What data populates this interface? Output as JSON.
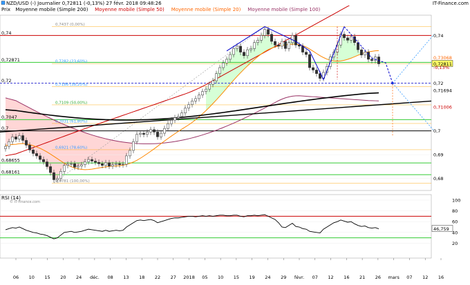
{
  "header": {
    "line1_left": "NZD/USD (-) Journalier 0,72811 (-0,13%) 27 févr. 2018 09:48:26",
    "line1_right": "IT-Finance.com",
    "legend": [
      {
        "label": "Prix",
        "color": "#000000"
      },
      {
        "label": "Moyenne mobile (Simple 200)",
        "color": "#000000"
      },
      {
        "label": "Moyenne mobile (Simple 50)",
        "color": "#cc0000"
      },
      {
        "label": "Moyenne mobile (Simple 20)",
        "color": "#ff6600"
      },
      {
        "label": "Moyenne mobile (Simple 100)",
        "color": "#993366"
      }
    ]
  },
  "colors": {
    "up_candle": "#ffffff",
    "down_candle": "#333333",
    "sma200": "#000000",
    "sma50": "#cc0000",
    "sma20": "#ff8800",
    "sma100": "#993366",
    "fib": "#ffa500",
    "green": "#33cc33",
    "red_level": "#cc0000",
    "pattern": "#0000cc",
    "projection": "#3399ff"
  },
  "chart_data": [
    {
      "type": "candlestick",
      "title": "NZD/USD (-) Journalier",
      "last_value": "0,72811",
      "change": "-0,13%",
      "ylim": [
        0.675,
        0.7485
      ],
      "y_ticks": [
        "0,74",
        "0,72",
        "0,7",
        "0,69",
        "0,68"
      ],
      "left_labels": [
        "0,74",
        "0,72871",
        "0,72",
        "0,7047",
        "0,7",
        "0,68655",
        "0,68161"
      ],
      "right_labels": [
        {
          "text": "0,74",
          "value": 0.74,
          "color": "#000000",
          "bg": null
        },
        {
          "text": "0,73068",
          "value": 0.73068,
          "color": "#ff6600",
          "bg": null
        },
        {
          "text": "0,72811",
          "value": 0.72811,
          "color": "#000000",
          "bg": "#ffff66"
        },
        {
          "text": "-0,13%",
          "value": 0.7266,
          "color": "#cc0000",
          "bg": null
        },
        {
          "text": "0,72",
          "value": 0.72,
          "color": "#000000",
          "bg": null
        },
        {
          "text": "0,71694",
          "value": 0.71694,
          "color": "#000000",
          "bg": null
        },
        {
          "text": "0,71006",
          "value": 0.71006,
          "color": "#cc0000",
          "bg": null
        },
        {
          "text": "0,7",
          "value": 0.7,
          "color": "#000000",
          "bg": null
        },
        {
          "text": "0,69",
          "value": 0.69,
          "color": "#000000",
          "bg": null
        },
        {
          "text": "0,68",
          "value": 0.68,
          "color": "#000000",
          "bg": null
        }
      ],
      "x_labels": [
        "06",
        "10",
        "15",
        "20",
        "24",
        "déc.",
        "08",
        "13",
        "18",
        "22",
        "27",
        "2018",
        "05",
        "10",
        "15",
        "19",
        "24",
        "29",
        "févr.",
        "07",
        "12",
        "16",
        "21",
        "26",
        "mars",
        "07",
        "12",
        "16"
      ],
      "fib_levels": [
        {
          "label": "0,7437 (0,00%)",
          "value": 0.7437
        },
        {
          "label": "0,7282 (23,60%)",
          "value": 0.7282
        },
        {
          "label": "0,7186 (38,20%)",
          "value": 0.7186
        },
        {
          "label": "0,7109 (50,00%)",
          "value": 0.7109
        },
        {
          "label": "0,7031 (61,80%)",
          "value": 0.7031
        },
        {
          "label": "0,6921 (78,60%)",
          "value": 0.6921
        },
        {
          "label": "0,6781 (100,00%)",
          "value": 0.6781
        }
      ],
      "horizontal_levels": [
        {
          "value": 0.74,
          "color": "#cc0000"
        },
        {
          "value": 0.72871,
          "color": "#33cc33"
        },
        {
          "value": 0.7047,
          "color": "#33cc33"
        },
        {
          "value": 0.7,
          "color": "#000000"
        },
        {
          "value": 0.68655,
          "color": "#33cc33"
        },
        {
          "value": 0.68161,
          "color": "#33cc33"
        }
      ],
      "closes": [
        0.6935,
        0.6955,
        0.6975,
        0.6965,
        0.698,
        0.696,
        0.694,
        0.692,
        0.6905,
        0.6895,
        0.688,
        0.687,
        0.685,
        0.6825,
        0.6795,
        0.68,
        0.683,
        0.6855,
        0.686,
        0.6862,
        0.6848,
        0.6852,
        0.6858,
        0.687,
        0.688,
        0.6873,
        0.6868,
        0.6862,
        0.6855,
        0.6866,
        0.6852,
        0.6858,
        0.6862,
        0.6858,
        0.686,
        0.6895,
        0.6918,
        0.6955,
        0.6985,
        0.699,
        0.6985,
        0.6995,
        0.7005,
        0.6995,
        0.6975,
        0.699,
        0.701,
        0.703,
        0.7045,
        0.7055,
        0.706,
        0.7075,
        0.7095,
        0.711,
        0.7125,
        0.7135,
        0.715,
        0.7165,
        0.7175,
        0.7195,
        0.721,
        0.724,
        0.7265,
        0.7285,
        0.73,
        0.732,
        0.7345,
        0.7355,
        0.733,
        0.7315,
        0.734,
        0.7345,
        0.737,
        0.738,
        0.74,
        0.7425,
        0.7405,
        0.7375,
        0.736,
        0.7355,
        0.7375,
        0.7345,
        0.737,
        0.74,
        0.736,
        0.7355,
        0.733,
        0.732,
        0.7265,
        0.7255,
        0.724,
        0.722,
        0.7245,
        0.727,
        0.731,
        0.733,
        0.736,
        0.7405,
        0.739,
        0.738,
        0.7395,
        0.737,
        0.734,
        0.7318,
        0.733,
        0.73,
        0.7295,
        0.731,
        0.7281
      ],
      "rsi": {
        "label": "RSI (14)",
        "ylim": [
          0,
          100
        ],
        "y_ticks": [
          "100",
          "80",
          "60",
          "40",
          "20"
        ],
        "overbought": 70,
        "oversold": 30,
        "last_label": "46,759",
        "values": [
          45,
          47,
          49,
          48,
          50,
          47,
          44,
          42,
          40,
          39,
          37,
          36,
          34,
          31,
          28,
          30,
          35,
          40,
          41,
          42,
          40,
          41,
          42,
          44,
          46,
          45,
          44,
          43,
          42,
          44,
          42,
          43,
          44,
          43,
          44,
          50,
          54,
          58,
          62,
          63,
          62,
          63,
          64,
          62,
          58,
          60,
          62,
          64,
          66,
          67,
          67,
          68,
          69,
          70,
          70,
          69,
          70,
          71,
          70,
          71,
          70,
          71,
          72,
          72,
          71,
          71,
          72,
          72,
          70,
          69,
          71,
          71,
          72,
          71,
          72,
          73,
          70,
          67,
          64,
          58,
          50,
          49,
          53,
          57,
          51,
          50,
          47,
          46,
          42,
          41,
          40,
          39,
          46,
          50,
          54,
          58,
          60,
          63,
          61,
          59,
          60,
          56,
          53,
          51,
          52,
          49,
          48,
          49,
          46.759
        ]
      }
    }
  ]
}
